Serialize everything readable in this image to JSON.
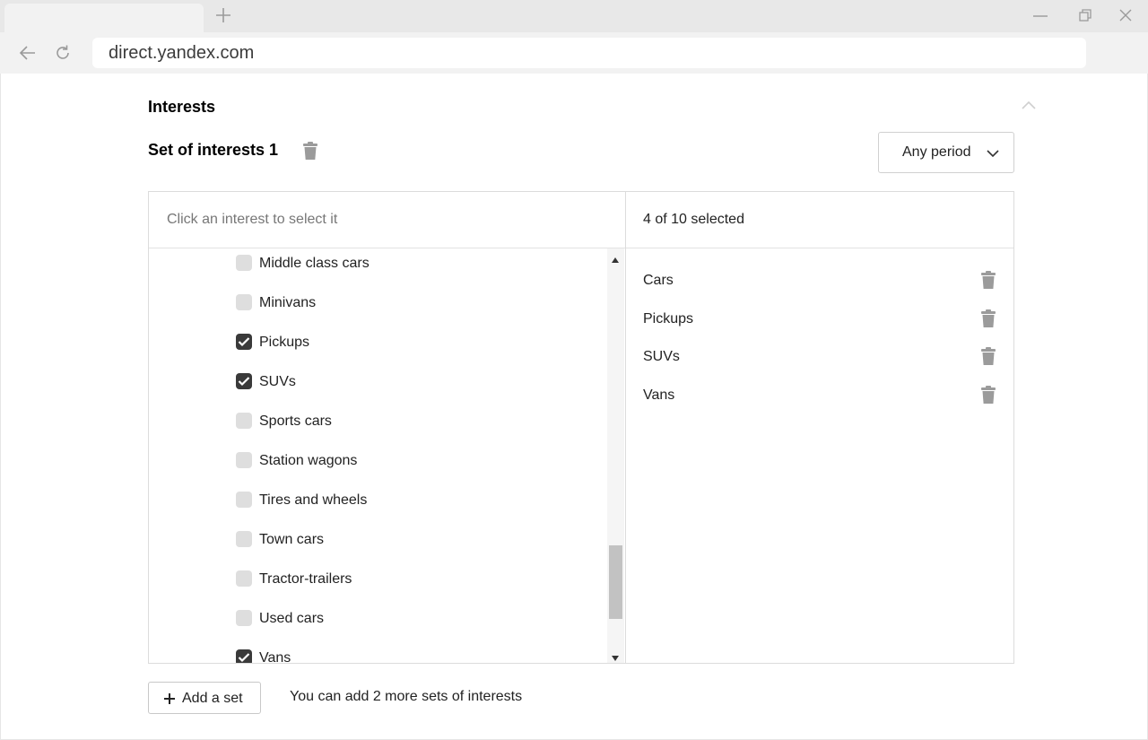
{
  "browser": {
    "url": "direct.yandex.com"
  },
  "section": {
    "title": "Interests"
  },
  "set": {
    "title": "Set of interests 1",
    "period": "Any period"
  },
  "list": {
    "hint": "Click an interest to select it",
    "items": [
      {
        "label": "Middle class cars",
        "checked": false
      },
      {
        "label": "Minivans",
        "checked": false
      },
      {
        "label": "Pickups",
        "checked": true
      },
      {
        "label": "SUVs",
        "checked": true
      },
      {
        "label": "Sports cars",
        "checked": false
      },
      {
        "label": "Station wagons",
        "checked": false
      },
      {
        "label": "Tires and wheels",
        "checked": false
      },
      {
        "label": "Town cars",
        "checked": false
      },
      {
        "label": "Tractor-trailers",
        "checked": false
      },
      {
        "label": "Used cars",
        "checked": false
      },
      {
        "label": "Vans",
        "checked": true
      }
    ]
  },
  "selected": {
    "count_label": "4 of 10 selected",
    "items": [
      "Cars",
      "Pickups",
      "SUVs",
      "Vans"
    ]
  },
  "footer": {
    "add_button": "Add a set",
    "note": "You can add 2 more sets of interests"
  },
  "colors": {
    "checkbox_checked": "#3a3a3a",
    "checkbox_unchecked": "#dedede",
    "icon_gray": "#9b9b9b"
  }
}
